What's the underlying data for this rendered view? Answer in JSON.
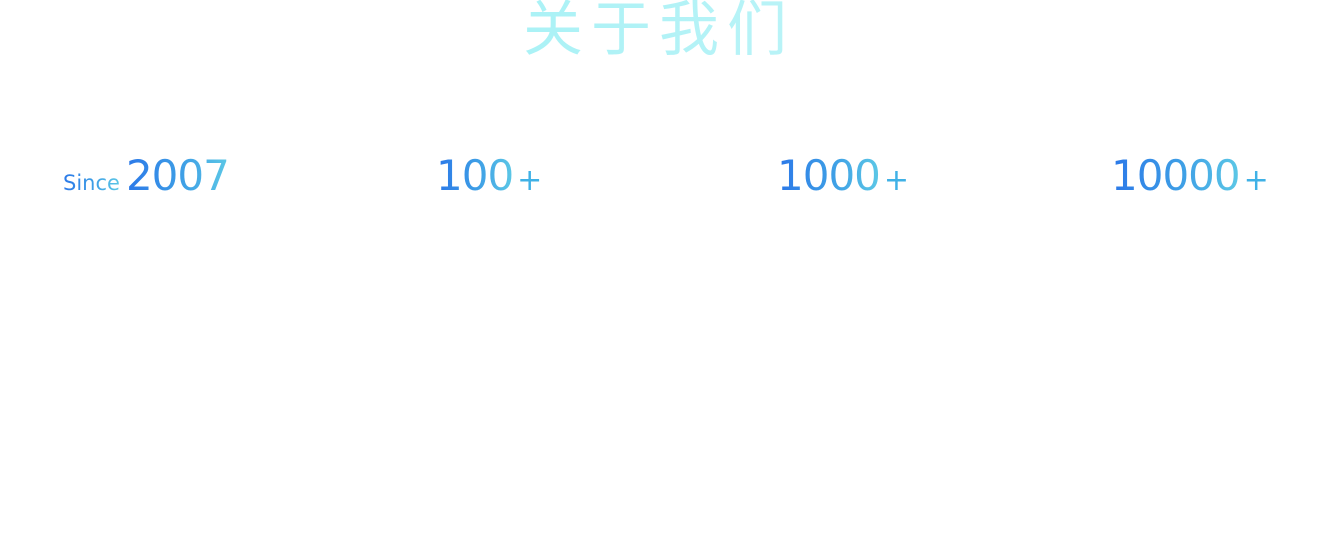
{
  "header": {
    "title": "关于我们"
  },
  "stats": [
    {
      "prefix": "Since",
      "value": "2007",
      "suffix": ""
    },
    {
      "prefix": "",
      "value": "100",
      "suffix": "+"
    },
    {
      "prefix": "",
      "value": "1000",
      "suffix": "+"
    },
    {
      "prefix": "",
      "value": "10000",
      "suffix": "+"
    }
  ],
  "colors": {
    "title_gradient_start": "#8ef0f4",
    "number_gradient_start": "#2b78e8",
    "number_gradient_end": "#5cc8e6"
  }
}
